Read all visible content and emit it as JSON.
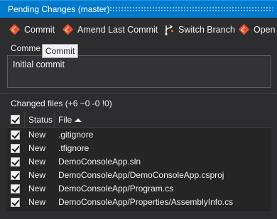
{
  "window": {
    "title": "Pending Changes (master)"
  },
  "toolbar": {
    "commit_label": "Commit",
    "amend_label": "Amend Last Commit",
    "switch_branch_label": "Switch Branch",
    "open_label": "Open A"
  },
  "tooltip": {
    "text": "Commit"
  },
  "comment": {
    "label": "Comme",
    "value": "Initial commit"
  },
  "changed_files": {
    "heading": "Changed files (+6 ~0 -0 !0)",
    "columns": {
      "status": "Status",
      "file": "File"
    },
    "rows": [
      {
        "status": "New",
        "file": ".gitignore"
      },
      {
        "status": "New",
        "file": ".tfignore"
      },
      {
        "status": "New",
        "file": "DemoConsoleApp.sln"
      },
      {
        "status": "New",
        "file": "DemoConsoleApp/DemoConsoleApp.csproj"
      },
      {
        "status": "New",
        "file": "DemoConsoleApp/Program.cs"
      },
      {
        "status": "New",
        "file": "DemoConsoleApp/Properties/AssemblyInfo.cs"
      }
    ]
  },
  "colors": {
    "accent": "#007acc",
    "background": "#2d2d30",
    "git_icon": "#e8542a"
  },
  "icons": [
    "git-commit-icon",
    "git-amend-icon",
    "switch-branch-icon",
    "git-open-icon",
    "sort-ascending-icon",
    "checkbox-checked-icon"
  ]
}
